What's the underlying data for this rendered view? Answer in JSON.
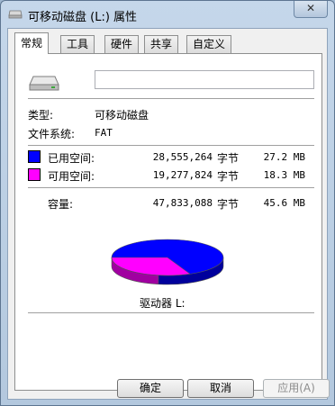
{
  "window": {
    "title": "可移动磁盘 (L:) 属性",
    "close_label": "✕"
  },
  "tabs": [
    "常规",
    "工具",
    "硬件",
    "共享",
    "自定义"
  ],
  "general": {
    "name_value": "",
    "type_label": "类型:",
    "type_value": "可移动磁盘",
    "fs_label": "文件系统:",
    "fs_value": "FAT",
    "used": {
      "label": "已用空间:",
      "bytes": "28,555,264",
      "unit": "字节",
      "size": "27.2 MB",
      "color": "#0000ff"
    },
    "free": {
      "label": "可用空间:",
      "bytes": "19,277,824",
      "unit": "字节",
      "size": "18.3 MB",
      "color": "#ff00ff"
    },
    "capacity": {
      "label": "容量:",
      "bytes": "47,833,088",
      "unit": "字节",
      "size": "45.6 MB"
    },
    "drive_label": "驱动器 L:"
  },
  "buttons": {
    "ok": "确定",
    "cancel": "取消",
    "apply": "应用(A)"
  },
  "icons": {
    "title": "drive-icon",
    "close": "close-icon"
  }
}
